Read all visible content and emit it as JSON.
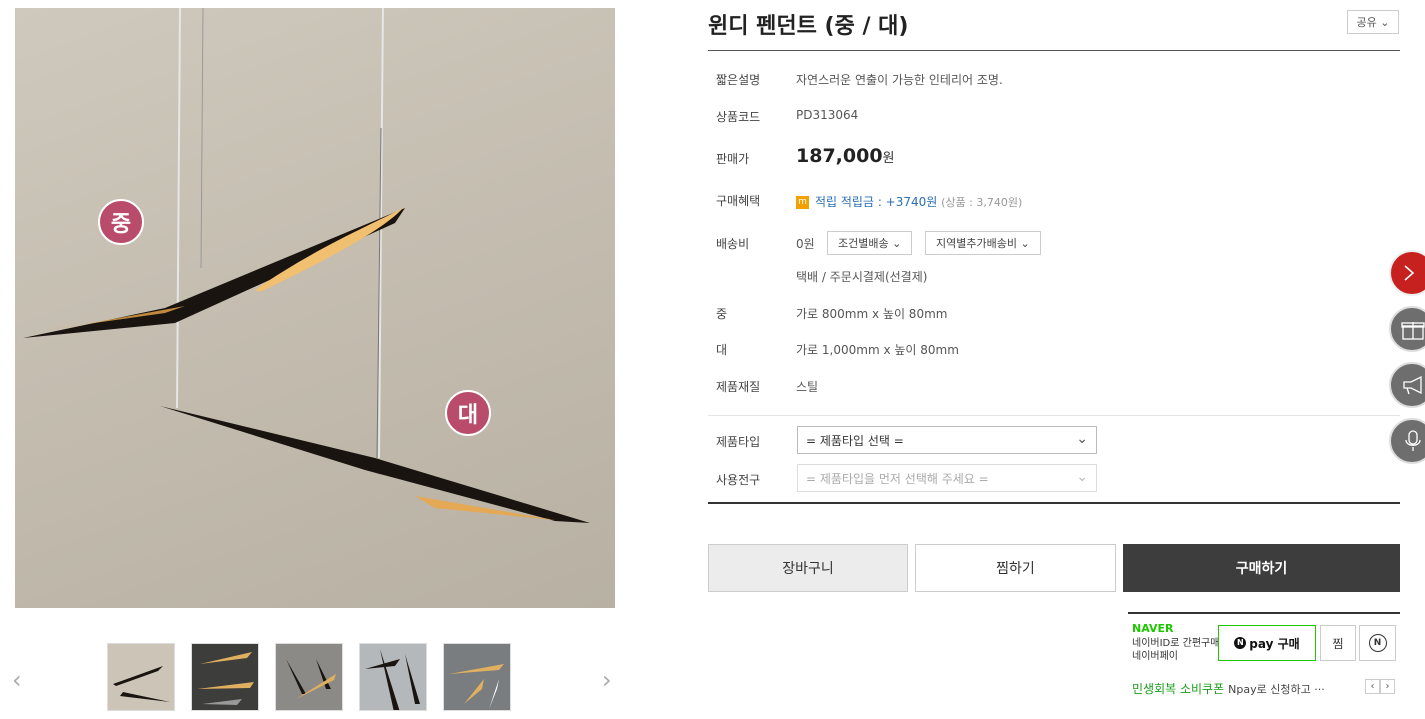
{
  "gallery": {
    "badge_medium": "중",
    "badge_large": "대",
    "prev": "‹",
    "next": "›"
  },
  "product": {
    "title": "윈디 펜던트 (중 / 대)",
    "share": "공유 ⌄",
    "rows": {
      "summary_label": "짧은설명",
      "summary_value": "자연스러운 연출이 가능한 인테리어 조명.",
      "code_label": "상품코드",
      "code_value": "PD313064",
      "price_label": "판매가",
      "price_value": "187,000",
      "price_unit": "원",
      "benefit_label": "구매혜택",
      "benefit_icon": "m",
      "benefit_text": "적립 적립금 : +3740원",
      "benefit_sub": "(상품 : 3,740원)",
      "shipping_label": "배송비",
      "shipping_value": "0원",
      "shipping_btn1": "조건별배송 ⌄",
      "shipping_btn2": "지역별추가배송비 ⌄",
      "shipping_method": "택배  /  주문시결제(선결제)",
      "medium_label": "중",
      "medium_value": "가로 800mm x 높이 80mm",
      "large_label": "대",
      "large_value": "가로 1,000mm x 높이 80mm",
      "material_label": "제품재질",
      "material_value": "스틸"
    },
    "options": {
      "type_label": "제품타입",
      "type_select": "= 제품타입 선택 =",
      "bulb_label": "사용전구",
      "bulb_select": "= 제품타입을 먼저 선택해 주세요 ="
    },
    "buttons": {
      "cart": "장바구니",
      "wish": "찜하기",
      "buy": "구매하기"
    }
  },
  "naverpay": {
    "brand": "NAVER",
    "desc_line1": "네이버ID로 간편구매",
    "desc_line2": "네이버페이",
    "pay_label": "pay 구매",
    "pay_n": "N",
    "zzim": "찜",
    "talk": "N",
    "coupon_title": "민생회복 소비쿠폰",
    "coupon_sub": "Npay로 신청하고 ···",
    "arrow_prev": "‹",
    "arrow_next": "›"
  },
  "floating": {
    "icons": [
      "chevron-right-icon",
      "gift-icon",
      "megaphone-icon",
      "microphone-icon"
    ]
  }
}
